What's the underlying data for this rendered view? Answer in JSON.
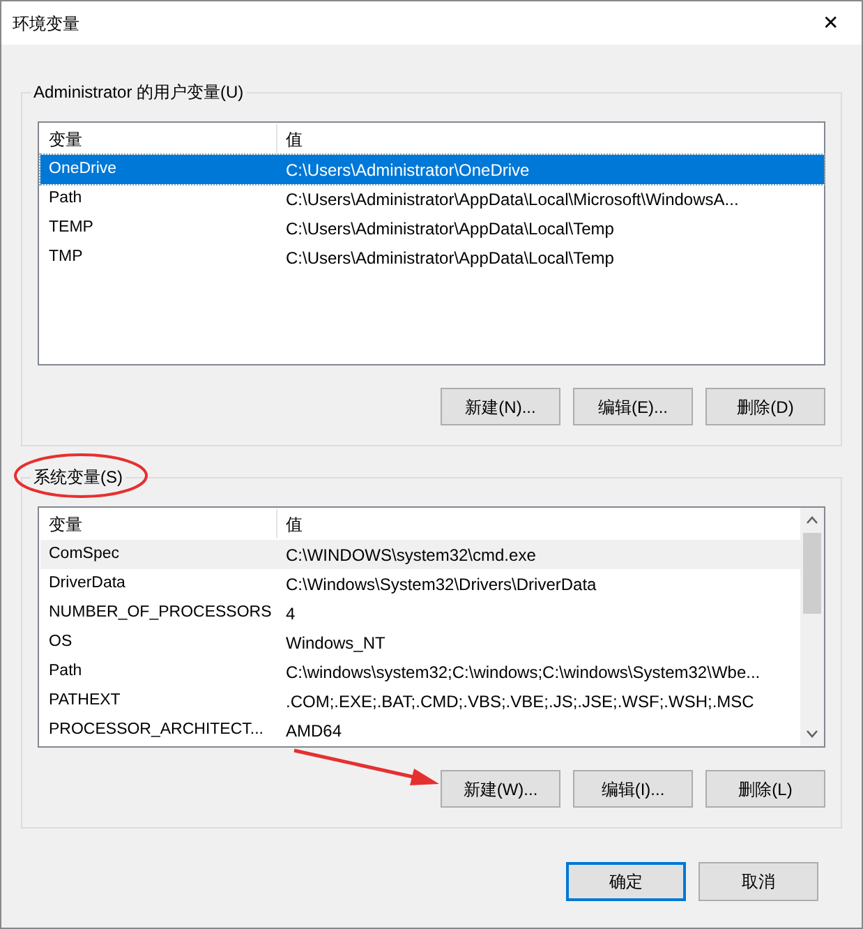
{
  "window": {
    "title": "环境变量",
    "close": "✕"
  },
  "groups": [
    {
      "title": "Administrator 的用户变量(U)",
      "focused": true,
      "scrollbar": false,
      "columns": [
        "变量",
        "值"
      ],
      "rows": [
        {
          "name": "OneDrive",
          "value": "C:\\Users\\Administrator\\OneDrive",
          "selected": true
        },
        {
          "name": "Path",
          "value": "C:\\Users\\Administrator\\AppData\\Local\\Microsoft\\WindowsA...",
          "selected": false
        },
        {
          "name": "TEMP",
          "value": "C:\\Users\\Administrator\\AppData\\Local\\Temp",
          "selected": false
        },
        {
          "name": "TMP",
          "value": "C:\\Users\\Administrator\\AppData\\Local\\Temp",
          "selected": false
        }
      ],
      "buttons": [
        "新建(N)...",
        "编辑(E)...",
        "删除(D)"
      ]
    },
    {
      "title": "系统变量(S)",
      "focused": false,
      "scrollbar": true,
      "columns": [
        "变量",
        "值"
      ],
      "rows": [
        {
          "name": "ComSpec",
          "value": "C:\\WINDOWS\\system32\\cmd.exe",
          "selected": true
        },
        {
          "name": "DriverData",
          "value": "C:\\Windows\\System32\\Drivers\\DriverData",
          "selected": false
        },
        {
          "name": "NUMBER_OF_PROCESSORS",
          "value": "4",
          "selected": false
        },
        {
          "name": "OS",
          "value": "Windows_NT",
          "selected": false
        },
        {
          "name": "Path",
          "value": "C:\\windows\\system32;C:\\windows;C:\\windows\\System32\\Wbe...",
          "selected": false
        },
        {
          "name": "PATHEXT",
          "value": ".COM;.EXE;.BAT;.CMD;.VBS;.VBE;.JS;.JSE;.WSF;.WSH;.MSC",
          "selected": false
        },
        {
          "name": "PROCESSOR_ARCHITECT...",
          "value": "AMD64",
          "selected": false
        }
      ],
      "buttons": [
        "新建(W)...",
        "编辑(I)...",
        "删除(L)"
      ]
    }
  ],
  "footer_buttons": [
    {
      "label": "确定",
      "default": true
    },
    {
      "label": "取消",
      "default": false
    }
  ]
}
